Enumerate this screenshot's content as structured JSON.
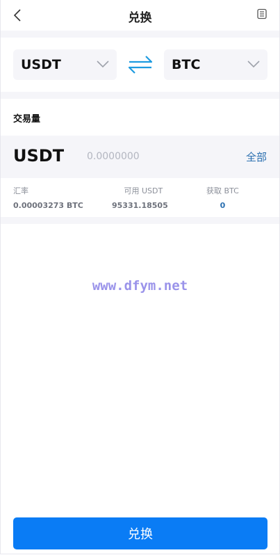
{
  "header": {
    "title": "兑换"
  },
  "pair": {
    "from": "USDT",
    "to": "BTC"
  },
  "amount": {
    "label": "交易量",
    "currency": "USDT",
    "placeholder": "0.0000000",
    "all_label": "全部"
  },
  "info": {
    "rate_label": "汇率",
    "rate_value": "0.00003273 BTC",
    "available_label": "可用 USDT",
    "available_value": "95331.18505",
    "receive_label": "获取 BTC",
    "receive_value": "0"
  },
  "watermark": "www.dfym.net",
  "submit_label": "兑换",
  "colors": {
    "accent": "#0a7cf5",
    "link": "#2a6fb0",
    "swap_icon": "#1e9be0",
    "panel_bg": "#f5f5f9"
  }
}
